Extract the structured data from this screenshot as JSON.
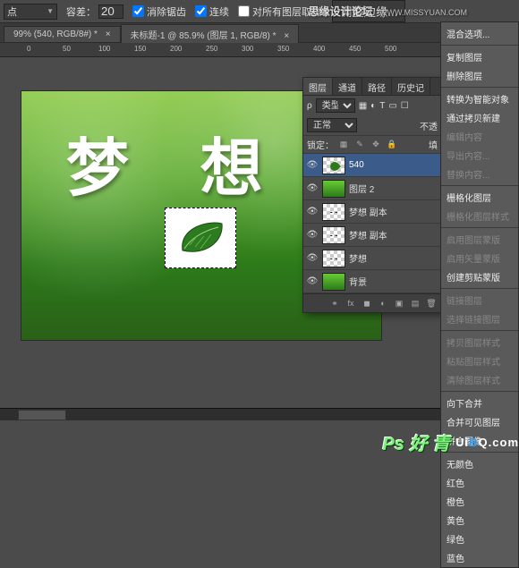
{
  "toolbar": {
    "mode_label": "点",
    "tolerance_label": "容差：",
    "tolerance_value": "20",
    "anti_alias": "消除锯齿",
    "contiguous": "连续",
    "all_layers": "对所有图层取样",
    "refine_edge": "调整边缘..."
  },
  "tabs": {
    "t1": "99% (540, RGB/8#) *",
    "t2": "未标题-1 @ 85.9% (图层 1, RGB/8) *"
  },
  "ruler": {
    "m0": "0",
    "m50": "50",
    "m100": "100",
    "m150": "150",
    "m200": "200",
    "m250": "250",
    "m300": "300",
    "m350": "350",
    "m400": "400",
    "m450": "450",
    "m500": "500"
  },
  "canvas": {
    "text": "梦 想"
  },
  "panel": {
    "tabs": {
      "layers": "图层",
      "channels": "通道",
      "paths": "路径",
      "history": "历史记"
    },
    "filter_label": "类型",
    "blend_mode": "正常",
    "opacity_label": "不透",
    "lock_label": "锁定：",
    "fill_label": "填",
    "layers": [
      {
        "name": "540",
        "kind": "leaf",
        "active": true
      },
      {
        "name": "图层 2",
        "kind": "grass-strip"
      },
      {
        "name": "梦想 副本",
        "kind": "text"
      },
      {
        "name": "梦想 副本",
        "kind": "text"
      },
      {
        "name": "梦想",
        "kind": "text"
      },
      {
        "name": "背景",
        "kind": "grass"
      }
    ],
    "foot_fx": "fx"
  },
  "ctx": {
    "items": [
      {
        "t": "混合选项...",
        "d": false
      },
      {
        "sep": true
      },
      {
        "t": "复制图层",
        "d": false
      },
      {
        "t": "删除图层",
        "d": false
      },
      {
        "sep": true
      },
      {
        "t": "转换为智能对象",
        "d": false
      },
      {
        "t": "通过拷贝新建",
        "d": false
      },
      {
        "t": "编辑内容",
        "d": true
      },
      {
        "t": "导出内容...",
        "d": true
      },
      {
        "t": "替换内容...",
        "d": true
      },
      {
        "sep": true
      },
      {
        "t": "栅格化图层",
        "d": false
      },
      {
        "t": "栅格化图层样式",
        "d": true
      },
      {
        "sep": true
      },
      {
        "t": "启用图层蒙版",
        "d": true
      },
      {
        "t": "启用矢量蒙版",
        "d": true
      },
      {
        "t": "创建剪贴蒙版",
        "d": false
      },
      {
        "sep": true
      },
      {
        "t": "链接图层",
        "d": true
      },
      {
        "t": "选择链接图层",
        "d": true
      },
      {
        "sep": true
      },
      {
        "t": "拷贝图层样式",
        "d": true
      },
      {
        "t": "粘贴图层样式",
        "d": true
      },
      {
        "t": "清除图层样式",
        "d": true
      },
      {
        "sep": true
      },
      {
        "t": "向下合并",
        "d": false
      },
      {
        "t": "合并可见图层",
        "d": false
      },
      {
        "t": "拼合图像",
        "d": false
      },
      {
        "sep": true
      },
      {
        "t": "无颜色",
        "d": false
      },
      {
        "t": "红色",
        "d": false
      },
      {
        "t": "橙色",
        "d": false
      },
      {
        "t": "黄色",
        "d": false
      },
      {
        "t": "绿色",
        "d": false
      },
      {
        "t": "蓝色",
        "d": false
      }
    ]
  },
  "watermark": {
    "site1_name": "思缘设计论坛",
    "site1_url": "WWW.MISSYUAN.COM",
    "badge": "Ps 好 青",
    "site2": "UiBQ.com"
  }
}
